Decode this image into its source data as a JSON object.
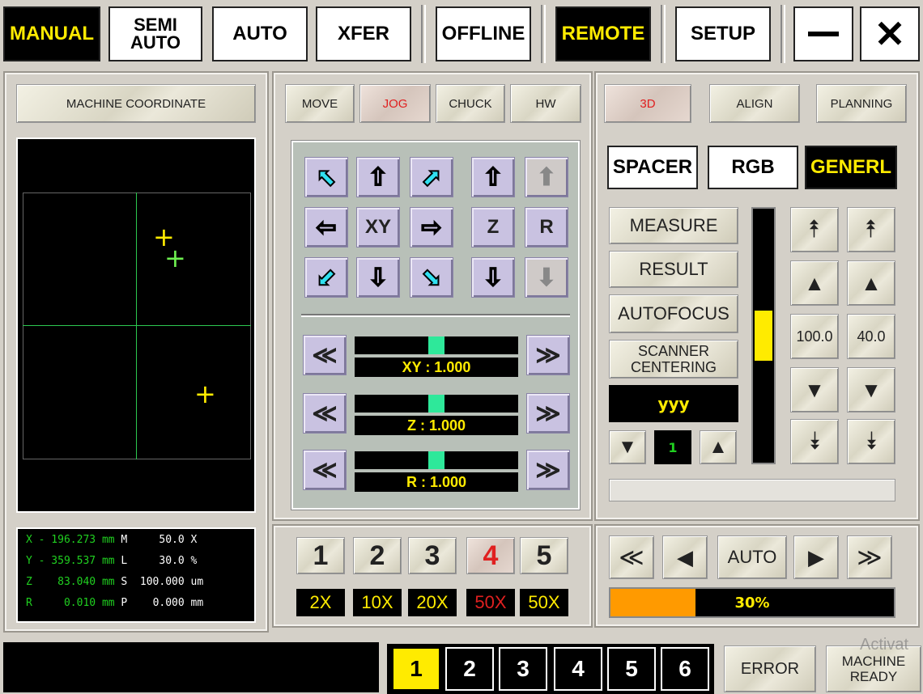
{
  "topbar": {
    "modes": [
      "MANUAL",
      "SEMI AUTO",
      "AUTO",
      "XFER"
    ],
    "offline": "OFFLINE",
    "remote": "REMOTE",
    "setup": "SETUP"
  },
  "left_panel": {
    "header": "MACHINE COORDINATE",
    "readout": {
      "rows": [
        {
          "axis": "X",
          "value": "- 196.273",
          "unit": "mm",
          "key": "M",
          "val2": "50.0",
          "unit2": "X"
        },
        {
          "axis": "Y",
          "value": "- 359.537",
          "unit": "mm",
          "key": "L",
          "val2": "30.0",
          "unit2": "%"
        },
        {
          "axis": "Z",
          "value": "83.040",
          "unit": "mm",
          "key": "S",
          "val2": "100.000",
          "unit2": "um"
        },
        {
          "axis": "R",
          "value": "0.010",
          "unit": "mm",
          "key": "P",
          "val2": "0.000",
          "unit2": "mm"
        }
      ]
    }
  },
  "center": {
    "tabs": [
      "MOVE",
      "JOG",
      "CHUCK",
      "HW"
    ],
    "active_tab": "JOG",
    "jog": {
      "xy_label": "XY",
      "z_label": "Z",
      "r_label": "R"
    },
    "speeds": [
      {
        "label": "XY : 1.000",
        "level": 0.5
      },
      {
        "label": "Z : 1.000",
        "level": 0.5
      },
      {
        "label": "R : 1.000",
        "level": 0.5
      }
    ],
    "lenses": [
      {
        "num": "1",
        "mag": "2X"
      },
      {
        "num": "2",
        "mag": "10X"
      },
      {
        "num": "3",
        "mag": "20X"
      },
      {
        "num": "4",
        "mag": "50X"
      },
      {
        "num": "5",
        "mag": "50X"
      }
    ],
    "active_lens": 3
  },
  "right": {
    "tabs": [
      "3D",
      "ALIGN",
      "PLANNING"
    ],
    "active_tab": "3D",
    "subtabs": [
      "SPACER",
      "RGB",
      "GENERL"
    ],
    "active_subtab": "GENERL",
    "buttons": {
      "measure": "MEASURE",
      "result": "RESULT",
      "autofocus": "AUTOFOCUS",
      "scanner": "SCANNER CENTERING"
    },
    "recipe_name": "yyy",
    "counter": "1",
    "level_values": [
      "100.0",
      "40.0"
    ],
    "vertical_level": 0.3,
    "auto_label": "AUTO",
    "progress_label": "30%",
    "progress": 0.3
  },
  "bottom": {
    "pages": [
      "1",
      "2",
      "3",
      "4",
      "5",
      "6"
    ],
    "active_page": "1",
    "error": "ERROR",
    "machine_ready": "MACHINE READY",
    "watermark": "Activat"
  },
  "colors": {
    "accent": "#ffeb00",
    "active_red": "#e02020",
    "green": "#20d020",
    "progress": "#ff9a00",
    "knob": "#2ee89a"
  }
}
